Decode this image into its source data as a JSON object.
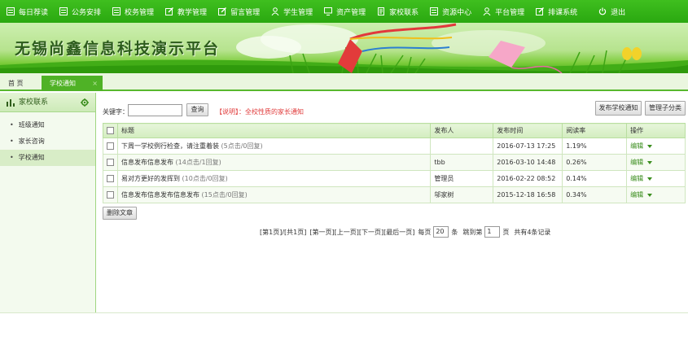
{
  "nav": [
    {
      "label": "每日荐读",
      "icon": "grid-icon"
    },
    {
      "label": "公务安排",
      "icon": "grid-icon"
    },
    {
      "label": "校务管理",
      "icon": "grid-icon"
    },
    {
      "label": "教学管理",
      "icon": "edit-icon"
    },
    {
      "label": "留言管理",
      "icon": "edit-icon"
    },
    {
      "label": "学生管理",
      "icon": "user-icon"
    },
    {
      "label": "资产管理",
      "icon": "monitor-icon"
    },
    {
      "label": "家校联系",
      "icon": "document-icon"
    },
    {
      "label": "资源中心",
      "icon": "grid-icon"
    },
    {
      "label": "平台管理",
      "icon": "user-icon"
    },
    {
      "label": "排课系统",
      "icon": "edit-icon"
    },
    {
      "label": "退出",
      "icon": "power-icon"
    }
  ],
  "banner": {
    "title": "无锡尚鑫信息科技演示平台"
  },
  "tabs": {
    "home": "首 页",
    "active": "学校通知",
    "close": "×"
  },
  "sidebar": {
    "title": "家校联系",
    "items": [
      "班级通知",
      "家长咨询",
      "学校通知"
    ],
    "active_index": 2
  },
  "toolbar": {
    "keyword_label": "关键字：",
    "keyword_value": "",
    "query_button": "查询",
    "note": "【说明】：全校性质的家长通知",
    "publish_button": "发布学校通知",
    "manage_button": "管理子分类"
  },
  "table": {
    "headers": [
      "标题",
      "发布人",
      "发布时间",
      "阅读率",
      "操作"
    ],
    "rows": [
      {
        "title": "下周一学校例行检查，请注重着装",
        "meta": "(5点击/0回复)",
        "author": "",
        "time": "2016-07-13 17:25",
        "rate": "1.19%",
        "op": "编辑"
      },
      {
        "title": "信息发布信息发布",
        "meta": "(14点击/1回复)",
        "author": "tbb",
        "time": "2016-03-10 14:48",
        "rate": "0.26%",
        "op": "编辑"
      },
      {
        "title": "易对方更好的发挥到",
        "meta": "(10点击/0回复)",
        "author": "管理员",
        "time": "2016-02-22 08:52",
        "rate": "0.14%",
        "op": "编辑"
      },
      {
        "title": "信息发布信息发布信息发布",
        "meta": "(15点击/0回复)",
        "author": "邬家树",
        "time": "2015-12-18 16:58",
        "rate": "0.34%",
        "op": "编辑"
      }
    ]
  },
  "delete_button": "删除文章",
  "pager": {
    "summary": "[第1页]/[共1页]",
    "links": "[第一页][上一页][下一页][最后一页]",
    "per_page_label": "每页",
    "per_page_value": "20",
    "per_page_unit": "条",
    "jump_label": "跳到第",
    "jump_value": "1",
    "jump_unit": "页",
    "total": "共有4条记录"
  }
}
